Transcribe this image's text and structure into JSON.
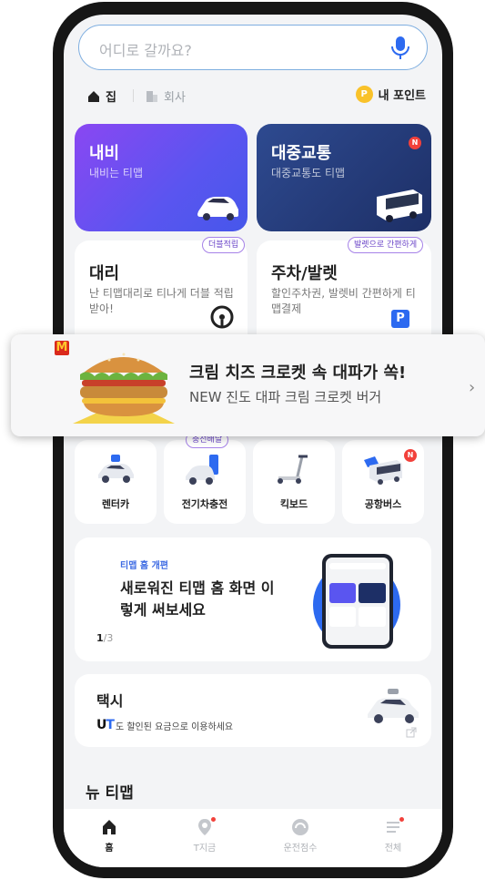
{
  "search": {
    "placeholder": "어디로 갈까요?"
  },
  "shortcuts": {
    "home": "집",
    "office": "회사",
    "points": "내 포인트",
    "points_icon": "P"
  },
  "cards": {
    "navi": {
      "title": "내비",
      "subtitle": "내비는 티맵"
    },
    "transit": {
      "title": "대중교통",
      "subtitle": "대중교통도 티맵",
      "badge": "N"
    },
    "driver": {
      "title": "대리",
      "subtitle": "난 티맵대리로 티나게 더블 적립 받아!",
      "tag": "더블적립"
    },
    "parking": {
      "title": "주차/발렛",
      "subtitle": "할인주차권, 발렛비 간편하게 티맵결제",
      "tag": "발렛으로 간편하게",
      "icon_letter": "P"
    }
  },
  "small_tiles": {
    "items": [
      {
        "label": "렌터카"
      },
      {
        "label": "전기차충전",
        "tag": "충전배달"
      },
      {
        "label": "킥보드"
      },
      {
        "label": "공항버스",
        "badge": "N"
      }
    ]
  },
  "banner": {
    "eyebrow": "티맵 홈 개편",
    "headline": "새로워진 티맵 홈 화면 이렇게 써보세요",
    "page_current": "1",
    "page_sep": "/",
    "page_total": "3"
  },
  "taxi": {
    "title": "택시",
    "logo_u": "U",
    "logo_t": "T",
    "subtitle": "도 할인된 요금으로 이용하세요"
  },
  "new_section": {
    "title": "뉴 티맵"
  },
  "tabbar": {
    "tabs": [
      {
        "label": "홈"
      },
      {
        "label": "T지금"
      },
      {
        "label": "운전점수"
      },
      {
        "label": "전체"
      }
    ]
  },
  "ad": {
    "brand": "M",
    "headline": "크림 치즈 크로켓 속 대파가 쏙!",
    "subline": "NEW 진도 대파 크림 크로켓 버거",
    "arrow": "›"
  },
  "colors": {
    "navi_gradient_start": "#8a47f2",
    "navi_gradient_end": "#4657ea",
    "transit_bg": "#1d2f66",
    "accent_blue": "#3e6be3",
    "badge_red": "#f2413b"
  }
}
